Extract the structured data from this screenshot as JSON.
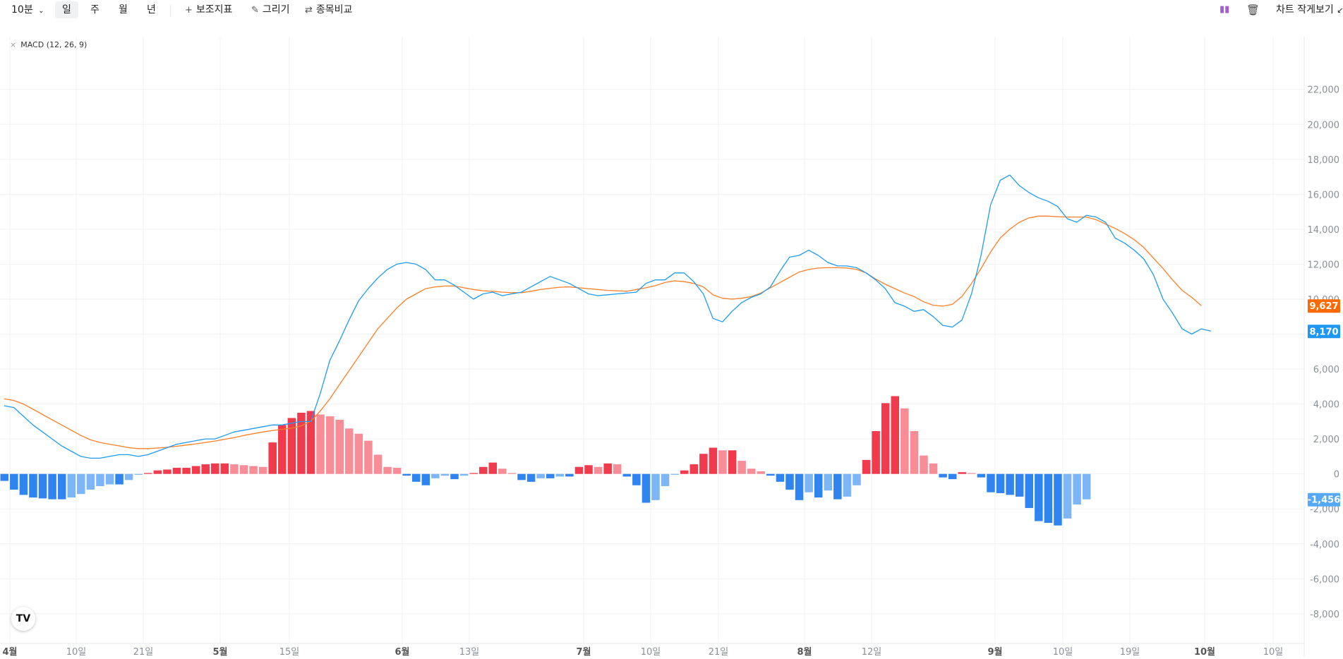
{
  "toolbar": {
    "interval": "10분",
    "periods": [
      "일",
      "주",
      "월",
      "년"
    ],
    "active_period": "일",
    "indicators_label": "보조지표",
    "draw_label": "그리기",
    "compare_label": "종목비교",
    "shrink_label": "차트 작게보기"
  },
  "chart_data": {
    "type": "line",
    "title": "MACD (12, 26, 9)",
    "x_tick_labels": [
      "4월",
      "10일",
      "21일",
      "5월",
      "15일",
      "6월",
      "13일",
      "7월",
      "10일",
      "21일",
      "8월",
      "12일",
      "9월",
      "10일",
      "19일",
      "10월",
      "10일"
    ],
    "y_ticks": [
      22000,
      20000,
      18000,
      16000,
      14000,
      12000,
      10000,
      8000,
      6000,
      4000,
      2000,
      0,
      -2000,
      -4000,
      -6000,
      -8000
    ],
    "ylim": [
      -9500,
      23200
    ],
    "grid": true,
    "series": [
      {
        "values": [
          3900,
          3800,
          3300,
          2800,
          2400,
          2000,
          1600,
          1300,
          1000,
          900,
          900,
          1000,
          1100,
          1100,
          1000,
          1100,
          1300,
          1500,
          1700,
          1800,
          1900,
          2000,
          2000,
          2200,
          2400,
          2500,
          2600,
          2700,
          2800,
          2800,
          2900,
          3000,
          3000,
          4600,
          6500,
          7600,
          8800,
          9900,
          10600,
          11200,
          11700,
          12000,
          12100,
          12000,
          11700,
          11100,
          11100,
          10800,
          10400,
          10000,
          10300,
          10400,
          10200,
          10300,
          10400,
          10700,
          11000,
          11300,
          11100,
          10900,
          10600,
          10300,
          10200,
          10250,
          10300,
          10350,
          10400,
          10900,
          11100,
          11100,
          11500,
          11500,
          11000,
          10300,
          8900,
          8700,
          9300,
          9800,
          10100,
          10300,
          10700,
          11600,
          12400,
          12500,
          12800,
          12500,
          12100,
          11900,
          11900,
          11800,
          11500,
          11100,
          10600,
          9800,
          9600,
          9300,
          9400,
          9000,
          8500,
          8400,
          8800,
          10300,
          12500,
          15400,
          16800,
          17100,
          16500,
          16100,
          15800,
          15600,
          15300,
          14600,
          14400,
          14800,
          14700,
          14400,
          13500,
          13200,
          12800,
          12300,
          11400,
          10000,
          9200,
          8300,
          8000,
          8300,
          8170
        ]
      },
      {
        "values": [
          4300,
          4200,
          4000,
          3700,
          3400,
          3100,
          2800,
          2500,
          2200,
          1950,
          1800,
          1700,
          1600,
          1500,
          1450,
          1450,
          1480,
          1520,
          1580,
          1650,
          1720,
          1800,
          1880,
          1980,
          2080,
          2200,
          2300,
          2400,
          2480,
          2550,
          2620,
          2750,
          3000,
          3600,
          4300,
          5100,
          5900,
          6700,
          7500,
          8300,
          8900,
          9500,
          10000,
          10300,
          10600,
          10700,
          10750,
          10750,
          10650,
          10550,
          10480,
          10450,
          10400,
          10370,
          10370,
          10450,
          10550,
          10620,
          10680,
          10700,
          10650,
          10600,
          10550,
          10500,
          10480,
          10450,
          10550,
          10650,
          10780,
          10950,
          11050,
          11000,
          10900,
          10700,
          10250,
          10050,
          10000,
          10050,
          10150,
          10350,
          10650,
          10950,
          11250,
          11550,
          11700,
          11780,
          11800,
          11800,
          11780,
          11700,
          11500,
          11150,
          10850,
          10600,
          10350,
          10150,
          9850,
          9650,
          9600,
          9700,
          10150,
          10900,
          11750,
          12700,
          13500,
          14000,
          14400,
          14650,
          14750,
          14750,
          14720,
          14700,
          14700,
          14700,
          14550,
          14300,
          14050,
          13750,
          13400,
          12950,
          12350,
          11750,
          11100,
          10500,
          10100,
          9627
        ]
      }
    ],
    "histogram": [
      -400,
      -900,
      -1200,
      -1350,
      -1400,
      -1450,
      -1450,
      -1350,
      -1150,
      -900,
      -700,
      -600,
      -600,
      -350,
      -50,
      50,
      200,
      250,
      350,
      350,
      450,
      550,
      600,
      600,
      550,
      500,
      450,
      400,
      1800,
      2800,
      3200,
      3500,
      3600,
      3400,
      3300,
      3100,
      2600,
      2300,
      1900,
      1100,
      400,
      350,
      -100,
      -450,
      -650,
      -250,
      -100,
      -300,
      -100,
      50,
      400,
      650,
      300,
      50,
      -350,
      -450,
      -250,
      -250,
      -150,
      -150,
      400,
      500,
      400,
      600,
      550,
      -150,
      -650,
      -1650,
      -1500,
      -700,
      -50,
      200,
      550,
      1150,
      1500,
      1350,
      1350,
      750,
      300,
      150,
      -100,
      -450,
      -900,
      -1500,
      -1050,
      -1350,
      -950,
      -1450,
      -1300,
      -650,
      800,
      2450,
      4050,
      4450,
      3750,
      2450,
      1050,
      600,
      -200,
      -300,
      100,
      50,
      -200,
      -1050,
      -1100,
      -1200,
      -1300,
      -1950,
      -2700,
      -2800,
      -2950,
      -2550,
      -1750,
      -1456
    ],
    "last_values": {
      "signal": "9,627",
      "macd": "8,170",
      "histogram": "-1,456"
    },
    "colors": {
      "macd_line": "#1e9bf0",
      "signal_line": "#ff7f27",
      "hist_up_strong": "#f13a4b",
      "hist_up_weak": "#f98d97",
      "hist_down_strong": "#2f84ef",
      "hist_down_weak": "#7cb6f6",
      "grid": "#f0f2f5",
      "axis_text": "#8a8f98",
      "signal_label_bg": "#ff6a00",
      "macd_label_bg": "#1f96f3",
      "hist_label_bg": "#54a8f5"
    }
  }
}
